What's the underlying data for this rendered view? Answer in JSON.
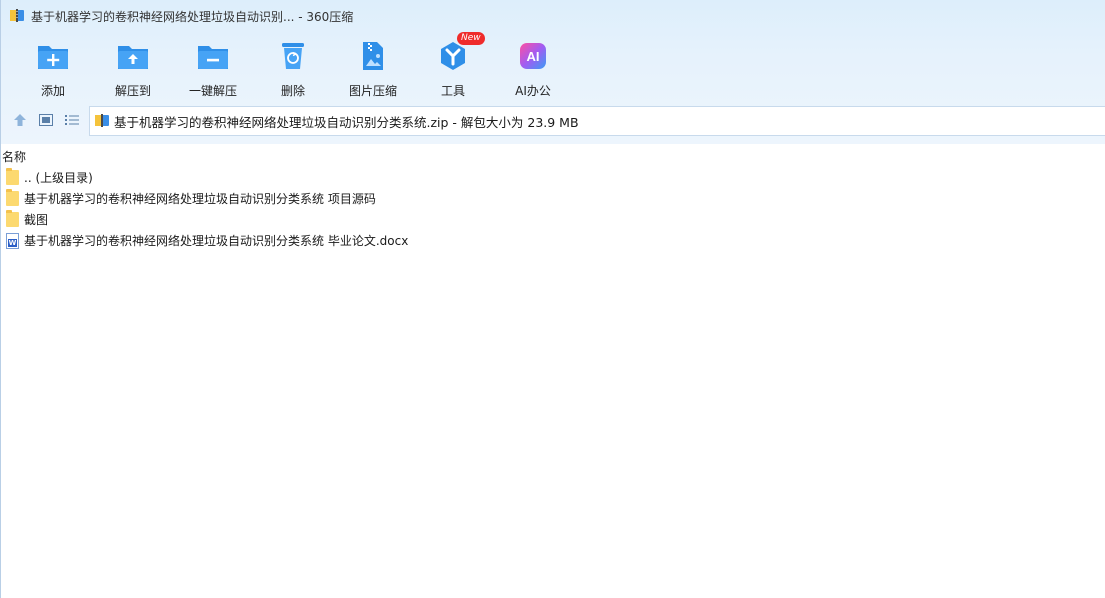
{
  "window": {
    "title": "基于机器学习的卷积神经网络处理垃圾自动识别... - 360压缩"
  },
  "toolbar": {
    "items": [
      {
        "label": "添加",
        "icon": "add-folder-icon"
      },
      {
        "label": "解压到",
        "icon": "extract-to-folder-icon"
      },
      {
        "label": "一键解压",
        "icon": "one-click-extract-icon"
      },
      {
        "label": "删除",
        "icon": "recycle-bin-icon"
      },
      {
        "label": "图片压缩",
        "icon": "image-zip-icon"
      },
      {
        "label": "工具",
        "icon": "tools-hexagon-icon",
        "badge": "New"
      },
      {
        "label": "AI办公",
        "icon": "ai-office-icon"
      }
    ]
  },
  "address": {
    "text": "基于机器学习的卷积神经网络处理垃圾自动识别分类系统.zip - 解包大小为 23.9 MB"
  },
  "filelist": {
    "header": "名称",
    "rows": [
      {
        "name": ".. (上级目录)",
        "type": "folder"
      },
      {
        "name": "基于机器学习的卷积神经网络处理垃圾自动识别分类系统 项目源码",
        "type": "folder"
      },
      {
        "name": "截图",
        "type": "folder"
      },
      {
        "name": "基于机器学习的卷积神经网络处理垃圾自动识别分类系统 毕业论文.docx",
        "type": "docx"
      }
    ]
  },
  "colors": {
    "accent": "#2f8fe8",
    "badge": "#ef2b2b",
    "folder": "#fcd970"
  }
}
